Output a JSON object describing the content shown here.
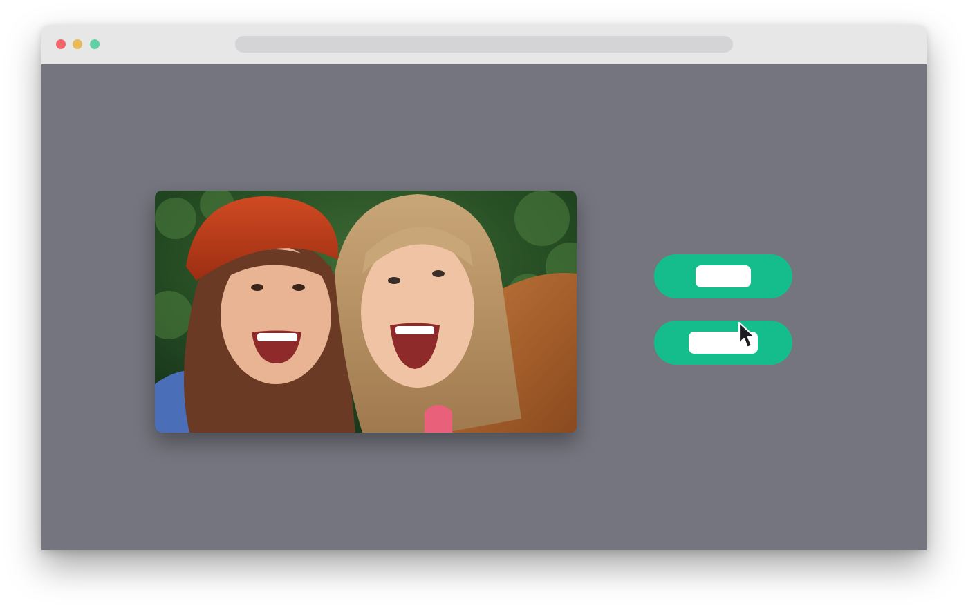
{
  "colors": {
    "titlebar": "#e7e7e8",
    "address_bar": "#d4d4d6",
    "viewport_bg": "#75757f",
    "button_green": "#16bd8c",
    "traffic_close": "#f0666a",
    "traffic_minimize": "#e9b95a",
    "traffic_maximize": "#5fcfa5"
  },
  "titlebar": {
    "traffic_lights": [
      "close",
      "minimize",
      "maximize"
    ],
    "address_bar_text": ""
  },
  "main": {
    "photo": {
      "subject": "selfie-of-two-smiling-women"
    },
    "buttons": [
      {
        "label": ""
      },
      {
        "label": ""
      }
    ]
  },
  "cursor": {
    "icon": "arrow-cursor-icon",
    "hovering": "button-2"
  }
}
